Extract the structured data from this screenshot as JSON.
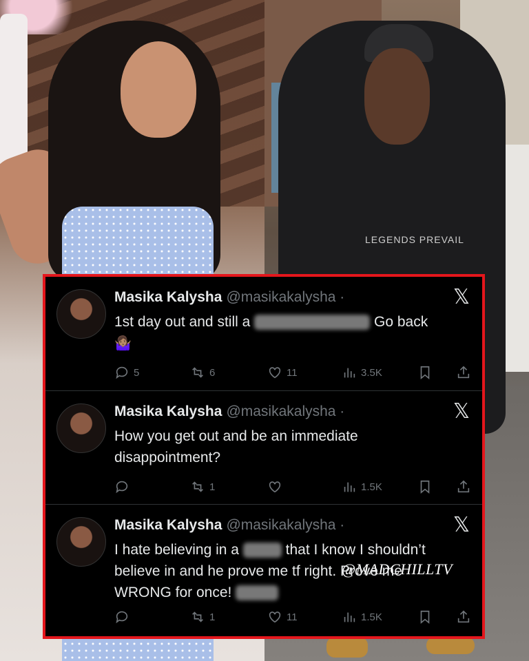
{
  "photo_left": {
    "description_icon": "woman-photo"
  },
  "photo_right": {
    "hoodie_text": "LEGENDS  PREVAIL"
  },
  "watermark": "@MADCHILLTV",
  "colors": {
    "panel_border": "#e4161c",
    "panel_bg": "#000000",
    "text": "#e7e9ea",
    "muted": "#71767b"
  },
  "tweets": [
    {
      "name": "Masika Kalysha",
      "handle": "@masikakalysha ·",
      "text_before": "1st day out and still a",
      "text_after": "Go back",
      "emoji": "🤷🏽‍♀️",
      "replies": "5",
      "reposts": "6",
      "likes": "11",
      "views": "3.5K"
    },
    {
      "name": "Masika Kalysha",
      "handle": "@masikakalysha ·",
      "line1": "How you get out and be an immediate",
      "line2": "disappointment?",
      "replies": "",
      "reposts": "1",
      "likes": "",
      "views": "1.5K"
    },
    {
      "name": "Masika Kalysha",
      "handle": "@masikakalysha ·",
      "line1_before": "I hate believing in a",
      "line1_after": "that I know I shouldn’t",
      "line2": "believe in and he prove me tf right. Prove me",
      "line3": "WRONG for once!",
      "replies": "",
      "reposts": "1",
      "likes": "11",
      "views": "1.5K"
    }
  ]
}
